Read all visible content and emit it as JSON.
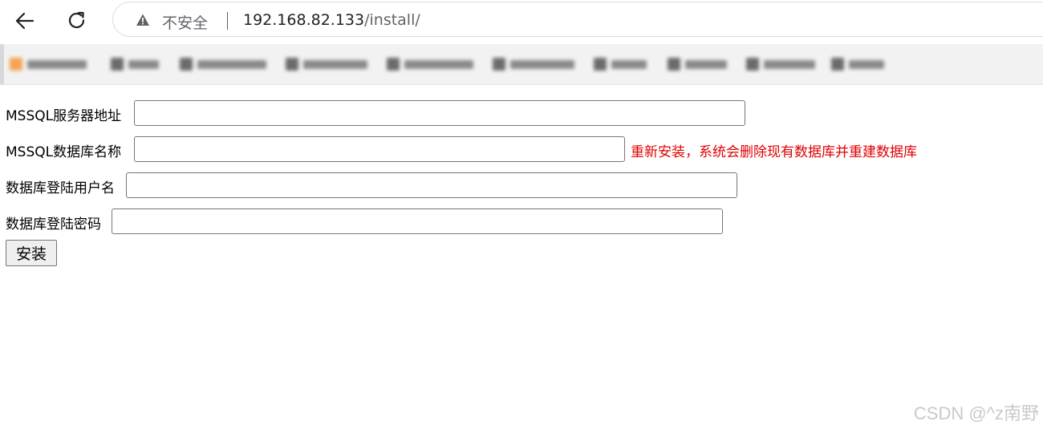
{
  "browser": {
    "security_text": "不安全",
    "url_host": "192.168.82.133",
    "url_path": "/install/",
    "icons": {
      "back": "back-arrow-icon",
      "reload": "reload-icon",
      "warning": "warning-triangle-icon"
    }
  },
  "form": {
    "server_label": "MSSQL服务器地址",
    "server_value": "",
    "dbname_label": "MSSQL数据库名称",
    "dbname_value": "",
    "dbname_note": "重新安装，系统会删除现有数据库并重建数据库",
    "user_label": "数据库登陆用户名",
    "user_value": "",
    "password_label": "数据库登陆密码",
    "password_value": "",
    "install_button": "安装",
    "note_color": "#e00000"
  },
  "watermark": "CSDN @^z南野"
}
